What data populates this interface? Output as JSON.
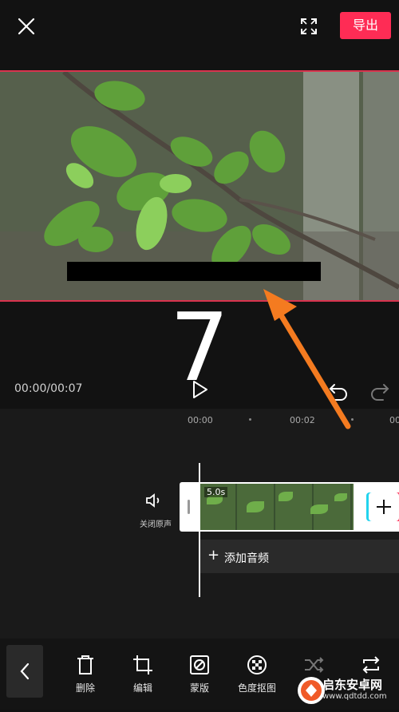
{
  "header": {
    "export_label": "导出",
    "close_icon": "close-icon",
    "fullscreen_icon": "fullscreen-icon",
    "accent": "#fe2c55"
  },
  "annotation": {
    "step_number": "7",
    "arrow_color": "#f47b20"
  },
  "playback": {
    "time": "00:00/00:07",
    "play_icon": "play-icon",
    "undo_icon": "undo-icon",
    "redo_icon": "redo-icon"
  },
  "timeline": {
    "ruler": [
      "00:00",
      "00:02",
      "00"
    ],
    "mute_label": "关闭原声",
    "clip_duration": "5.0s",
    "add_audio_label": "添加音频",
    "add_audio_plus": "+"
  },
  "toolbar": {
    "back_icon": "chevron-left-icon",
    "items": [
      {
        "label": "删除",
        "icon": "delete-icon"
      },
      {
        "label": "编辑",
        "icon": "crop-icon"
      },
      {
        "label": "蒙版",
        "icon": "mask-icon"
      },
      {
        "label": "色度抠图",
        "icon": "chroma-key-icon"
      }
    ]
  },
  "watermark": {
    "title": "启东安卓网",
    "url": "www.qdtdd.com"
  }
}
